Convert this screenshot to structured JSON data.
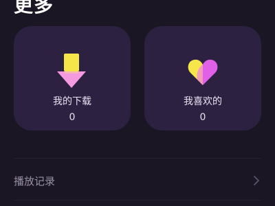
{
  "section": {
    "title": "更多"
  },
  "cards": {
    "downloads": {
      "label": "我的下载",
      "count": "0",
      "icon": "download-arrow-icon",
      "colors": {
        "top": "#f7e64a",
        "arrow": "#f59ae0"
      }
    },
    "favorites": {
      "label": "我喜欢的",
      "count": "0",
      "icon": "heart-icon",
      "colors": {
        "left": "#f7e64a",
        "right": "#e061e8"
      }
    }
  },
  "list": {
    "history": {
      "label": "播放记录",
      "icon": "chevron-right-icon"
    }
  }
}
